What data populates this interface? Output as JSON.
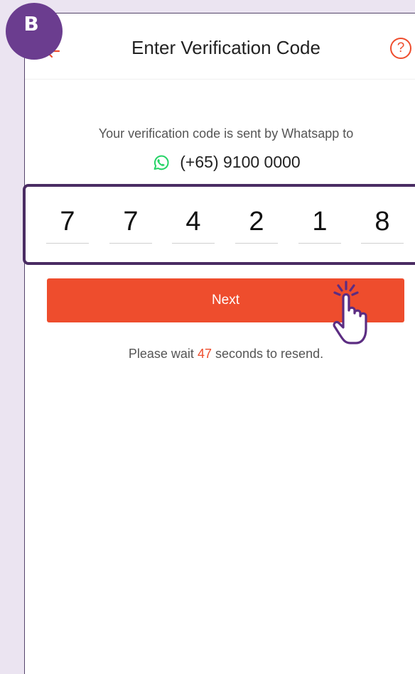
{
  "step_badge": "B",
  "header": {
    "title": "Enter Verification Code",
    "back_icon": "back-arrow-icon",
    "help_icon": "help-icon",
    "help_glyph": "?"
  },
  "info": {
    "message": "Your verification code is sent by Whatsapp to",
    "channel_icon": "whatsapp-icon",
    "phone_number": "(+65) 9100 0000"
  },
  "code": {
    "digits": [
      "7",
      "7",
      "4",
      "2",
      "1",
      "8"
    ]
  },
  "next_button": {
    "label": "Next"
  },
  "resend": {
    "prefix": "Please wait",
    "seconds": "47",
    "suffix": "seconds to resend."
  },
  "colors": {
    "accent": "#ee4d2d",
    "whatsapp": "#25d366",
    "highlight": "#4a2c63",
    "background": "#ebe4f1"
  }
}
